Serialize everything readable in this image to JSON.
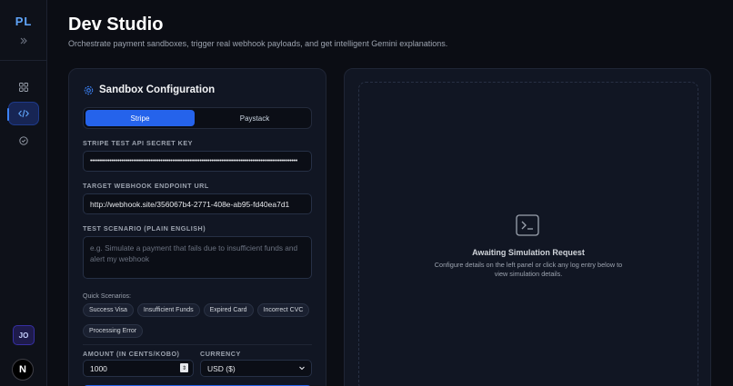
{
  "sidebar": {
    "logo": "PL",
    "avatar_initials": "JO",
    "brand_badge": "N"
  },
  "header": {
    "title": "Dev Studio",
    "subtitle": "Orchestrate payment sandboxes, trigger real webhook payloads, and get intelligent Gemini explanations."
  },
  "config": {
    "title": "Sandbox Configuration",
    "tabs": [
      {
        "label": "Stripe",
        "active": true
      },
      {
        "label": "Paystack",
        "active": false
      }
    ],
    "api_key_label": "STRIPE TEST API SECRET KEY",
    "api_key_value": "••••••••••••••••••••••••••••••••••••••••••••••••••••••••••••••••••••••••••••••••••••••••••••••••••••••••••",
    "webhook_label": "TARGET WEBHOOK ENDPOINT URL",
    "webhook_value": "http://webhook.site/356067b4-2771-408e-ab95-fd40ea7d1",
    "scenario_label": "TEST SCENARIO (PLAIN ENGLISH)",
    "scenario_placeholder": "e.g. Simulate a payment that fails due to insufficient funds and alert my webhook",
    "quick_label": "Quick Scenarios:",
    "quick_scenarios": [
      "Success Visa",
      "Insufficient Funds",
      "Expired Card",
      "Incorrect CVC",
      "Processing Error"
    ],
    "amount_label": "AMOUNT (IN CENTS/KOBO)",
    "amount_value": "1000",
    "currency_label": "CURRENCY",
    "currency_value": "USD ($)"
  },
  "preview": {
    "empty_title": "Awaiting Simulation Request",
    "empty_text": "Configure details on the left panel or click any log entry below to view simulation details."
  },
  "colors": {
    "accent": "#2563eb",
    "background": "#0b0d14",
    "card": "#111623"
  }
}
